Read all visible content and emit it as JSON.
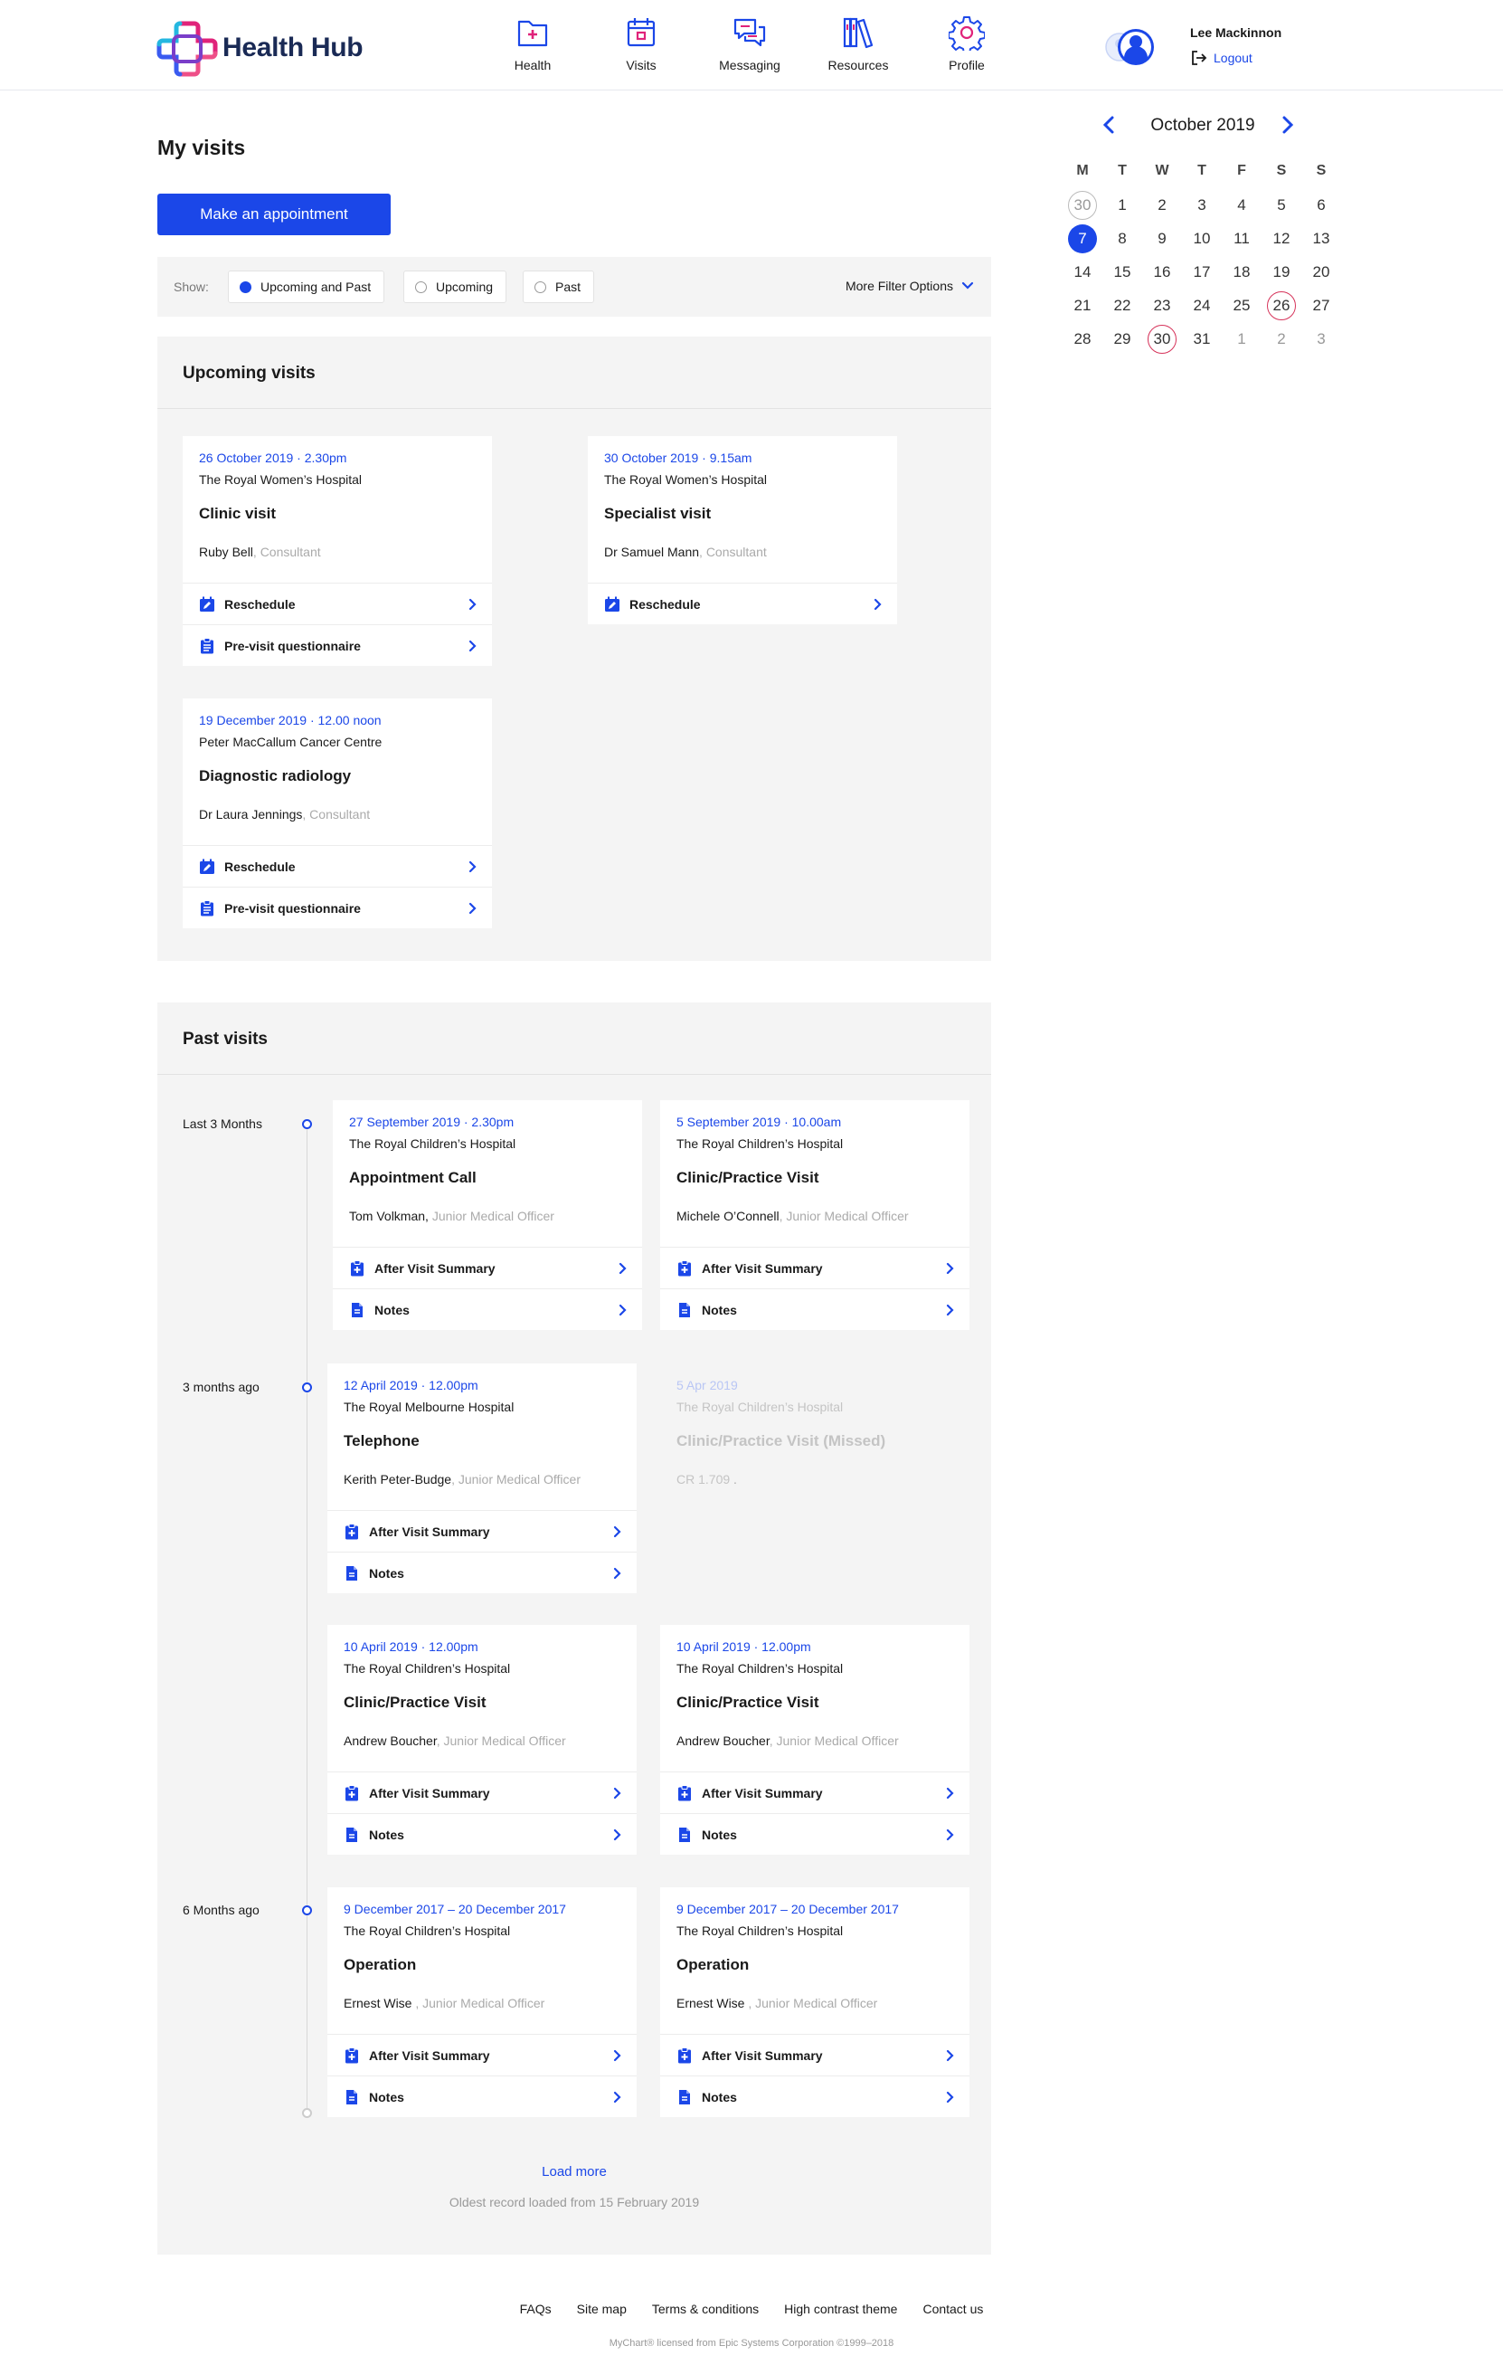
{
  "app": {
    "name": "Health Hub"
  },
  "nav": [
    {
      "label": "Health",
      "icon": "health-folder-icon"
    },
    {
      "label": "Visits",
      "icon": "calendar-icon"
    },
    {
      "label": "Messaging",
      "icon": "chat-bubbles-icon"
    },
    {
      "label": "Resources",
      "icon": "books-icon"
    },
    {
      "label": "Profile",
      "icon": "gear-icon"
    }
  ],
  "user": {
    "name": "Lee Mackinnon",
    "logout_label": "Logout"
  },
  "page": {
    "title": "My visits",
    "appointment_button": "Make an appointment"
  },
  "filter": {
    "show_label": "Show:",
    "options": [
      "Upcoming and Past",
      "Upcoming",
      "Past"
    ],
    "selected": "Upcoming and Past",
    "more_label": "More Filter Options"
  },
  "calendar": {
    "month_label": "October 2019",
    "weekdays": [
      "M",
      "T",
      "W",
      "T",
      "F",
      "S",
      "S"
    ],
    "weeks": [
      [
        "30",
        "1",
        "2",
        "3",
        "4",
        "5",
        "6"
      ],
      [
        "7",
        "8",
        "9",
        "10",
        "11",
        "12",
        "13"
      ],
      [
        "14",
        "15",
        "16",
        "17",
        "18",
        "19",
        "20"
      ],
      [
        "21",
        "22",
        "23",
        "24",
        "25",
        "26",
        "27"
      ],
      [
        "28",
        "29",
        "30",
        "31",
        "1",
        "2",
        "3"
      ]
    ],
    "selected_day": "7",
    "visit_days": [
      "26",
      "30"
    ]
  },
  "upcoming": {
    "heading": "Upcoming visits",
    "cards": [
      {
        "date": "26 October 2019 · 2.30pm",
        "location": "The Royal Women’s Hospital",
        "type": "Clinic visit",
        "doctor": "Ruby Bell",
        "role": ", Consultant",
        "actions": [
          "Reschedule",
          "Pre-visit questionnaire"
        ]
      },
      {
        "date": "30 October 2019 · 9.15am",
        "location": "The Royal Women’s Hospital",
        "type": "Specialist visit",
        "doctor": "Dr Samuel Mann",
        "role": ", Consultant",
        "actions": [
          "Reschedule"
        ]
      },
      {
        "date": "19 December 2019 · 12.00 noon",
        "location": "Peter MacCallum Cancer Centre",
        "type": "Diagnostic radiology",
        "doctor": "Dr Laura Jennings",
        "role": ", Consultant",
        "actions": [
          "Reschedule",
          "Pre-visit questionnaire"
        ]
      }
    ]
  },
  "past": {
    "heading": "Past visits",
    "groups": [
      "Last 3 Months",
      "3 months ago",
      "6 Months ago"
    ],
    "cards": [
      {
        "date": "27 September 2019 · 2.30pm",
        "location": "The Royal Children’s Hospital",
        "type": "Appointment Call",
        "doctor": "Tom Volkman,",
        "role": " Junior Medical Officer",
        "actions": [
          "After Visit Summary",
          "Notes"
        ]
      },
      {
        "date": "5 September 2019 · 10.00am",
        "location": "The Royal Children’s Hospital",
        "type": "Clinic/Practice Visit",
        "doctor": "Michele O’Connell",
        "role": ", Junior Medical Officer",
        "actions": [
          "After Visit Summary",
          "Notes"
        ]
      },
      {
        "date": "12 April 2019 · 12.00pm",
        "location": "The Royal Melbourne Hospital",
        "type": "Telephone",
        "doctor": "Kerith Peter-Budge",
        "role": ", Junior Medical Officer",
        "actions": [
          "After Visit Summary",
          "Notes"
        ]
      },
      {
        "date": "5 Apr 2019",
        "location": "The Royal Children’s Hospital",
        "type": "Clinic/Practice Visit (Missed)",
        "doctor": "CR 1.709",
        "role": "     .",
        "actions": []
      },
      {
        "date": "10 April 2019 · 12.00pm",
        "location": "The Royal Children’s Hospital",
        "type": "Clinic/Practice Visit",
        "doctor": "Andrew Boucher",
        "role": ", Junior Medical Officer",
        "actions": [
          "After Visit Summary",
          "Notes"
        ]
      },
      {
        "date": "10 April 2019 · 12.00pm",
        "location": "The Royal Children’s Hospital",
        "type": "Clinic/Practice Visit",
        "doctor": "Andrew Boucher",
        "role": ", Junior Medical Officer",
        "actions": [
          "After Visit Summary",
          "Notes"
        ]
      },
      {
        "date": "9 December 2017 – 20 December 2017",
        "location": "The Royal Children’s Hospital",
        "type": "Operation",
        "doctor": "Ernest Wise",
        "role": "    , Junior Medical Officer",
        "actions": [
          "After Visit Summary",
          "Notes"
        ]
      },
      {
        "date": "9 December 2017 – 20 December 2017",
        "location": "The Royal Children’s Hospital",
        "type": "Operation",
        "doctor": "Ernest Wise",
        "role": "    , Junior Medical Officer",
        "actions": [
          "After Visit Summary",
          "Notes"
        ]
      }
    ],
    "load_more": "Load more",
    "oldest_note": "Oldest record loaded from 15 February 2019"
  },
  "footer": {
    "links": [
      "FAQs",
      "Site map",
      "Terms & conditions",
      "High contrast theme",
      "Contact us"
    ],
    "copyright": "MyChart® licensed from Epic Systems Corporation ©1999–2018"
  },
  "colors": {
    "accent": "#1b47e8",
    "panel": "#f4f4f4",
    "visit_ring": "#d6335a"
  }
}
